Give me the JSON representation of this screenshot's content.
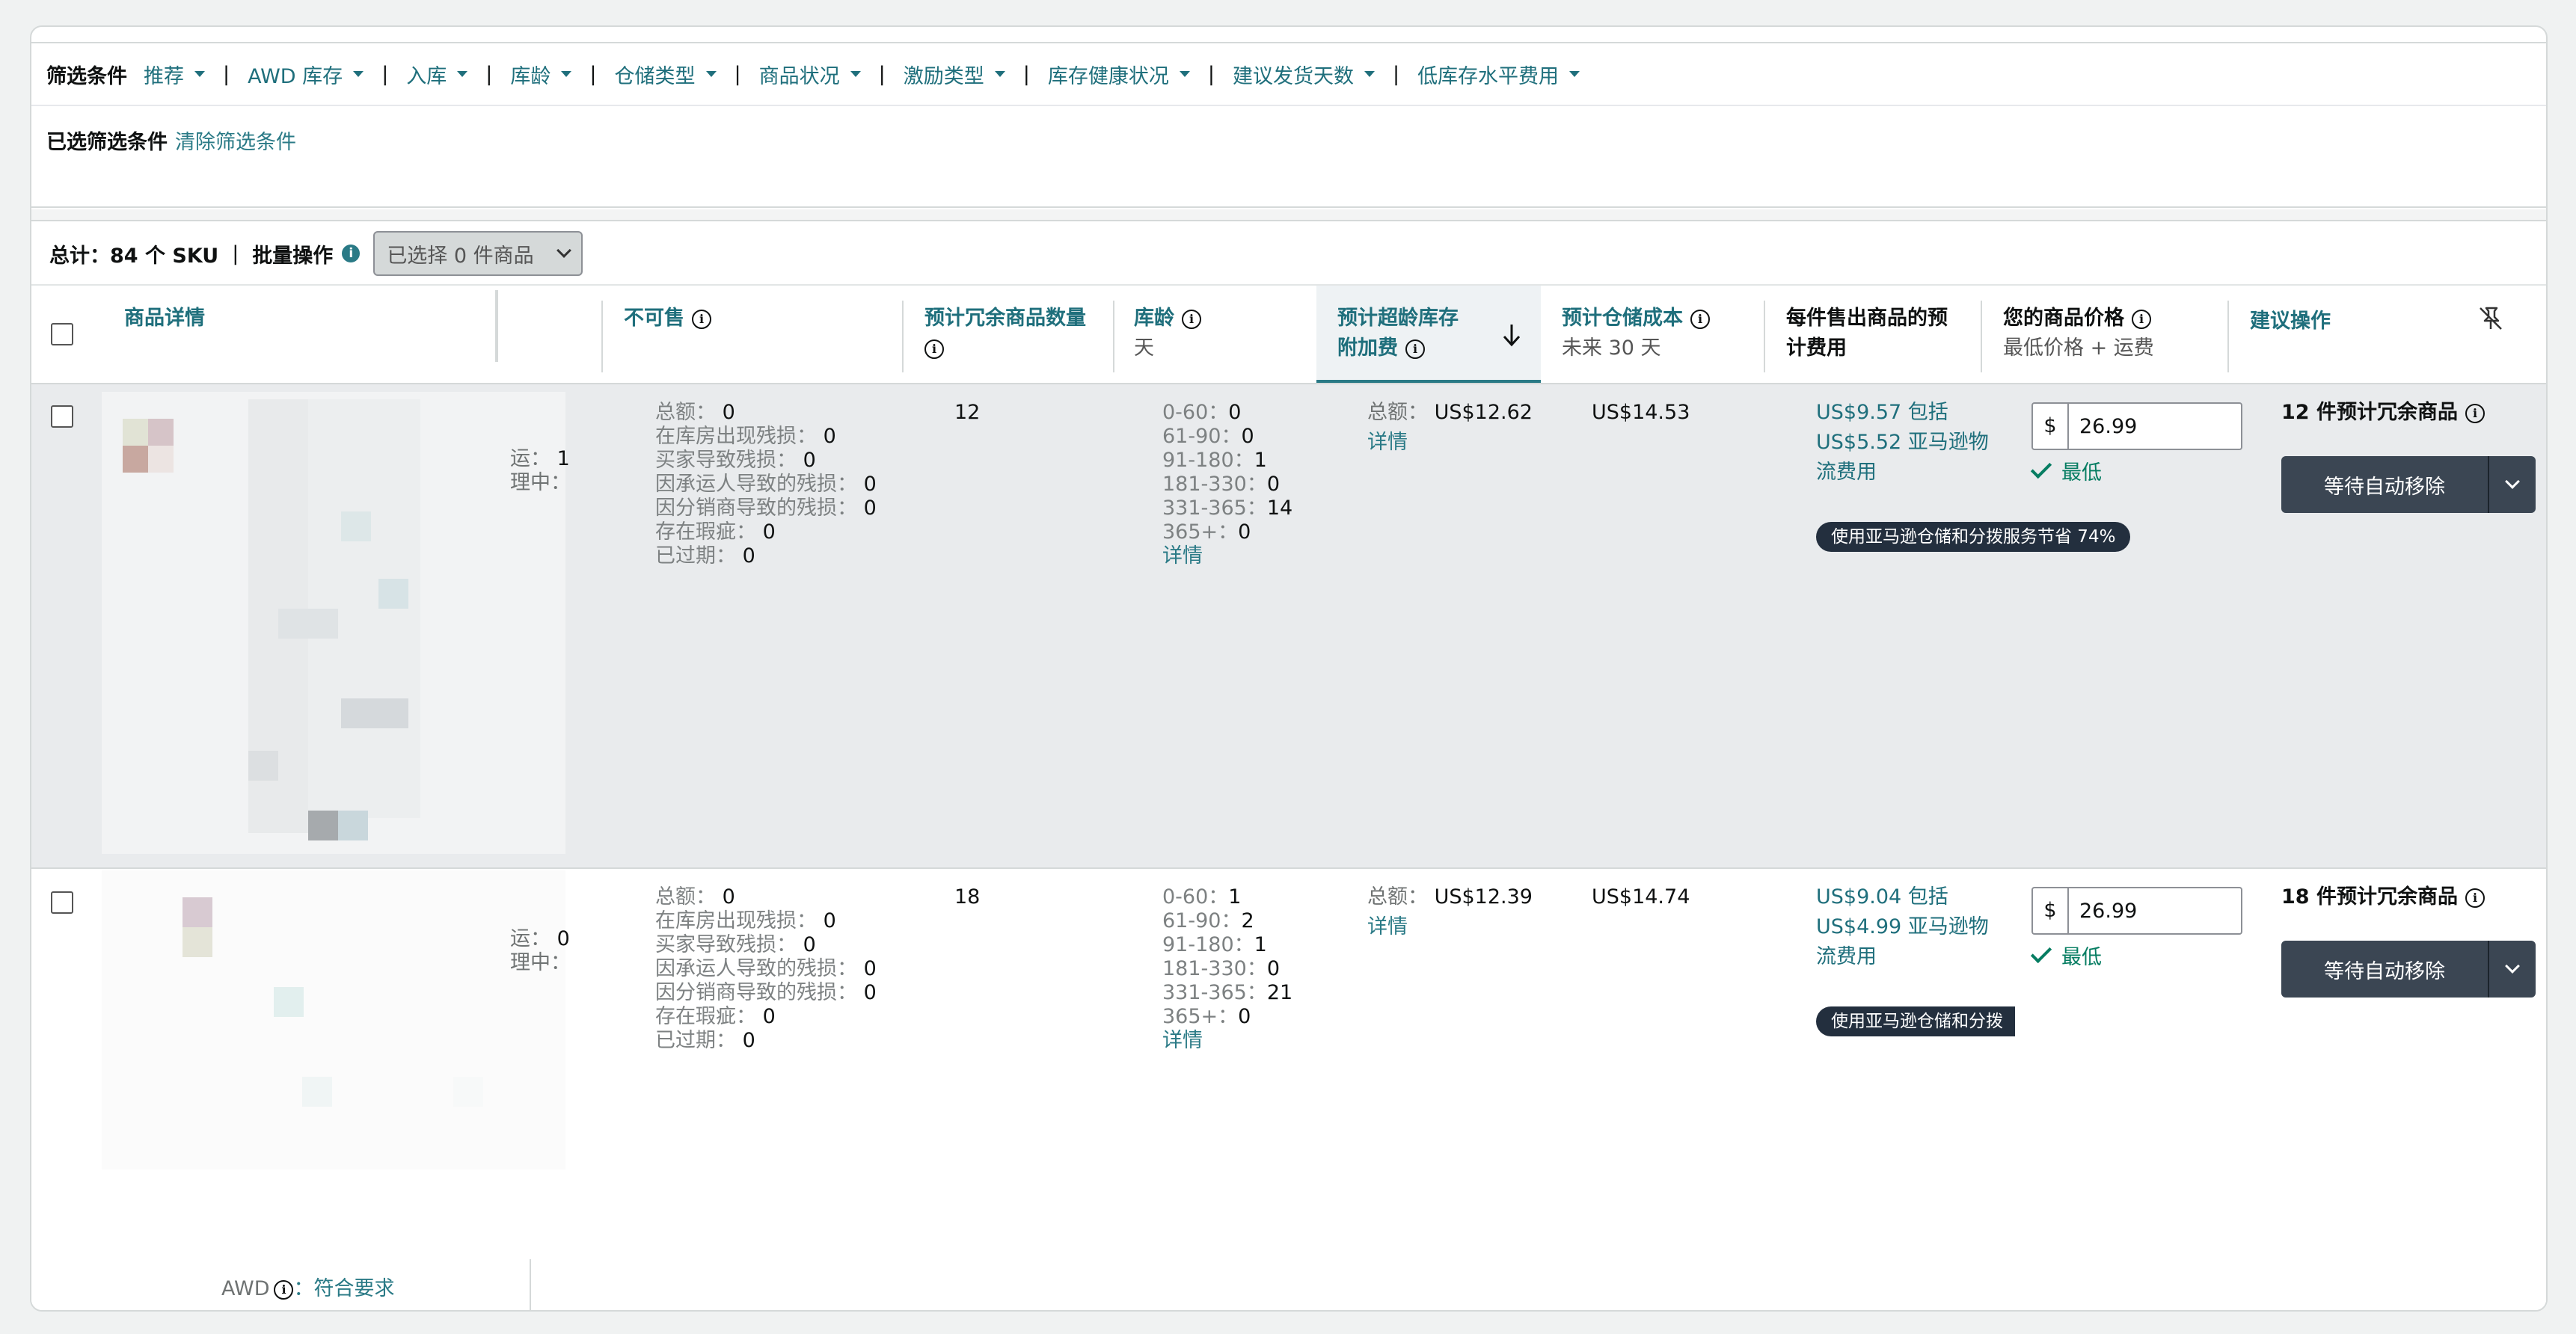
{
  "filters": {
    "label": "筛选条件",
    "items": [
      "推荐",
      "AWD 库存",
      "入库",
      "库龄",
      "仓储类型",
      "商品状况",
      "激励类型",
      "库存健康状况",
      "建议发货天数",
      "低库存水平费用"
    ],
    "separator": "|",
    "selected_label": "已选筛选条件",
    "clear_label": "清除筛选条件"
  },
  "summary": {
    "total": "总计：84 个 SKU",
    "separator": "|",
    "bulk_label": "批量操作",
    "bulk_select": "已选择 0 件商品"
  },
  "columns": {
    "product": "商品详情",
    "unsellable": "不可售",
    "excess_qty": "预计冗余商品数量",
    "age": "库龄",
    "age_sub": "天",
    "surcharge": "预计超龄库存",
    "surcharge2": "附加费",
    "storage": "预计仓储成本",
    "storage_sub": "未来 30 天",
    "fee": "每件售出商品的预",
    "fee2": "计费用",
    "price": "您的商品价格",
    "price_sub": "最低价格 + 运费",
    "action": "建议操作"
  },
  "rows": [
    {
      "partial1": "运：",
      "partial1_v": "1",
      "partial2": "理中：",
      "unsellable": [
        {
          "k": "总额：",
          "v": "0"
        },
        {
          "k": "在库房出现残损：",
          "v": "0"
        },
        {
          "k": "买家导致残损：",
          "v": "0"
        },
        {
          "k": "因承运人导致的残损：",
          "v": "0"
        },
        {
          "k": "因分销商导致的残损：",
          "v": "0"
        },
        {
          "k": "存在瑕疵：",
          "v": "0"
        },
        {
          "k": "已过期：",
          "v": "0"
        }
      ],
      "excess": "12",
      "age": [
        {
          "k": "0-60：",
          "v": "0"
        },
        {
          "k": "61-90：",
          "v": "0"
        },
        {
          "k": "91-180：",
          "v": "1"
        },
        {
          "k": "181-330：",
          "v": "0"
        },
        {
          "k": "331-365：",
          "v": "14"
        },
        {
          "k": "365+：",
          "v": "0"
        }
      ],
      "age_link": "详情",
      "surcharge_label": "总额：",
      "surcharge_value": "US$12.62",
      "surcharge_link": "详情",
      "storage": "US$14.53",
      "fee_line1": "US$9.57 包括",
      "fee_line2": "US$5.52 亚马逊物",
      "fee_line3": "流费用",
      "savings": "使用亚马逊仓储和分拨服务节省 74%",
      "currency": "$",
      "price": "26.99",
      "lowest": "最低",
      "excess_text": "12 件预计冗余商品",
      "action_btn": "等待自动移除"
    },
    {
      "partial1": "运：",
      "partial1_v": "0",
      "partial2": "理中：",
      "unsellable": [
        {
          "k": "总额：",
          "v": "0"
        },
        {
          "k": "在库房出现残损：",
          "v": "0"
        },
        {
          "k": "买家导致残损：",
          "v": "0"
        },
        {
          "k": "因承运人导致的残损：",
          "v": "0"
        },
        {
          "k": "因分销商导致的残损：",
          "v": "0"
        },
        {
          "k": "存在瑕疵：",
          "v": "0"
        },
        {
          "k": "已过期：",
          "v": "0"
        }
      ],
      "excess": "18",
      "age": [
        {
          "k": "0-60：",
          "v": "1"
        },
        {
          "k": "61-90：",
          "v": "2"
        },
        {
          "k": "91-180：",
          "v": "1"
        },
        {
          "k": "181-330：",
          "v": "0"
        },
        {
          "k": "331-365：",
          "v": "21"
        },
        {
          "k": "365+：",
          "v": "0"
        }
      ],
      "age_link": "详情",
      "surcharge_label": "总额：",
      "surcharge_value": "US$12.39",
      "surcharge_link": "详情",
      "storage": "US$14.74",
      "fee_line1": "US$9.04 包括",
      "fee_line2": "US$4.99 亚马逊物",
      "fee_line3": "流费用",
      "savings": "使用亚马逊仓储和分拨",
      "currency": "$",
      "price": "26.99",
      "lowest": "最低",
      "excess_text": "18 件预计冗余商品",
      "action_btn": "等待自动移除"
    }
  ],
  "awd": {
    "label": "AWD",
    "status": "：符合要求"
  }
}
